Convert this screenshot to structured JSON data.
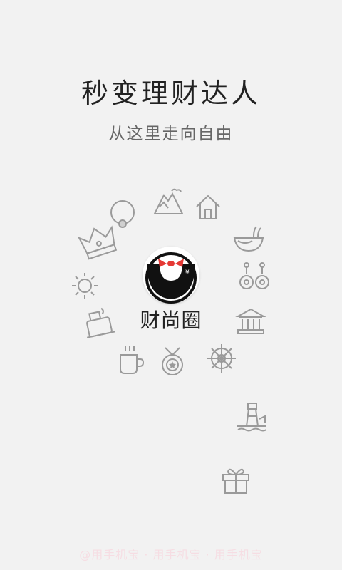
{
  "headline": "秒变理财达人",
  "subline": "从这里走向自由",
  "brand": {
    "name": "财尚圈"
  },
  "watermark": "@用手机宝 · 用手机宝 · 用手机宝",
  "colors": {
    "background": "#f2f2f2",
    "icon_stroke": "#9a9a9a",
    "text_dark": "#222222",
    "text_sub": "#666666",
    "logo_black": "#111111",
    "logo_bow": "#e53935"
  },
  "icons": [
    "ring-icon",
    "mountain-icon",
    "house-icon",
    "crown-icon",
    "bowl-icon",
    "sun-icon",
    "earrings-icon",
    "perfume-icon",
    "bank-icon",
    "coffee-cup-icon",
    "medal-icon",
    "ship-wheel-icon",
    "lighthouse-icon",
    "gift-icon"
  ]
}
